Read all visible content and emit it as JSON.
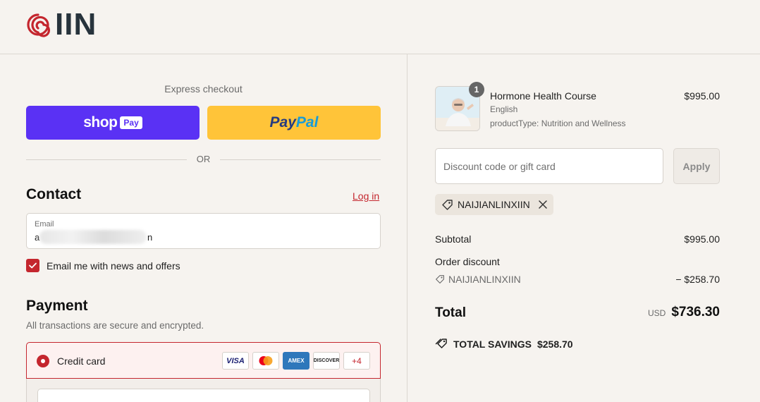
{
  "brand": {
    "logo_text": "IIN",
    "accent": "#c4262e"
  },
  "checkout": {
    "express_label": "Express checkout",
    "shop_pay": {
      "word": "shop",
      "tag": "Pay",
      "color": "#5a31f4"
    },
    "paypal": {
      "part1": "Pay",
      "part2": "Pal",
      "color": "#ffc439"
    },
    "or_label": "OR"
  },
  "contact": {
    "heading": "Contact",
    "login_label": "Log in",
    "email_label": "Email",
    "email_value_start": "a",
    "email_value_end": "n",
    "newsletter_label": "Email me with news and offers",
    "newsletter_checked": true
  },
  "payment": {
    "heading": "Payment",
    "subtitle": "All transactions are secure and encrypted.",
    "method_label": "Credit card",
    "cards": [
      "VISA",
      "mastercard-icon",
      "AMEX",
      "DISCOVER",
      "+4"
    ]
  },
  "order": {
    "quantity_badge": "1",
    "product_name": "Hormone Health Course",
    "product_language": "English",
    "product_type": "productType: Nutrition and Wellness",
    "product_price": "$995.00",
    "discount_placeholder": "Discount code or gift card",
    "apply_label": "Apply",
    "applied_code": "NAIJIANLINXIIN",
    "subtotal_label": "Subtotal",
    "subtotal_value": "$995.00",
    "order_discount_label": "Order discount",
    "discount_code": "NAIJIANLINXIIN",
    "discount_value": "− $258.70",
    "total_label": "Total",
    "total_currency": "USD",
    "total_value": "$736.30",
    "savings_label": "TOTAL SAVINGS",
    "savings_value": "$258.70"
  }
}
